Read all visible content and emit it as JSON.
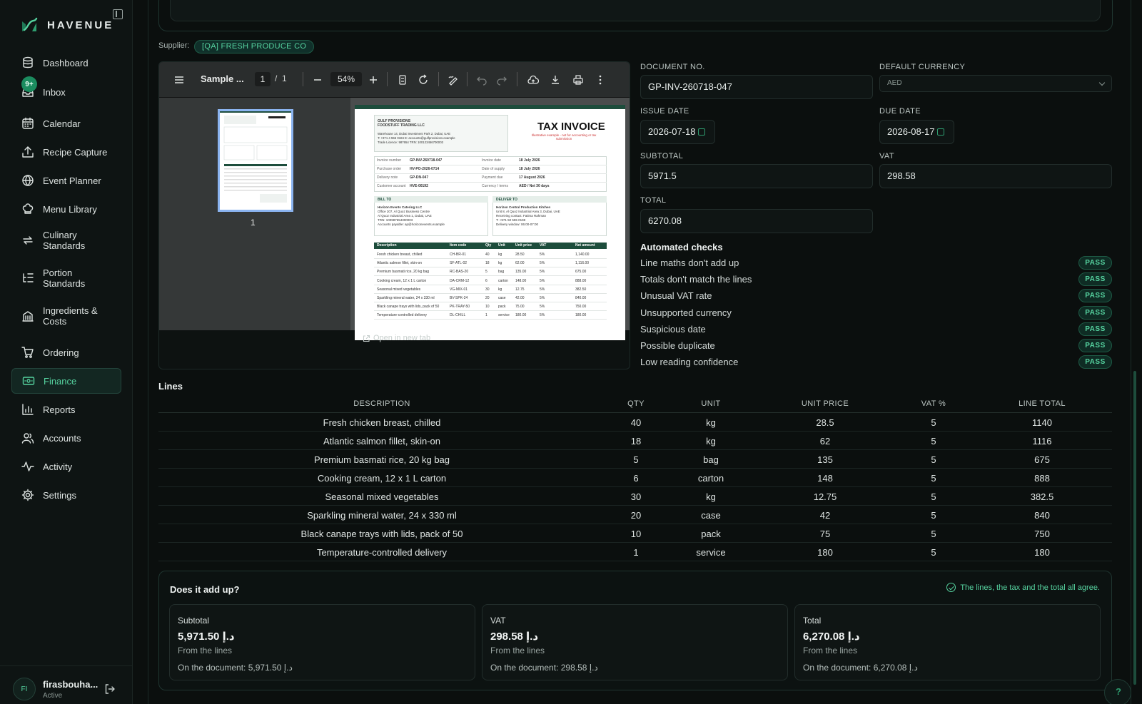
{
  "brand": {
    "name": "HAVENUE"
  },
  "sidebar": {
    "items": [
      {
        "label": "Dashboard",
        "icon": "database-icon"
      },
      {
        "label": "Inbox",
        "icon": "inbox-icon",
        "badge": "9+"
      },
      {
        "label": "Calendar",
        "icon": "calendar-icon"
      },
      {
        "label": "Recipe Capture",
        "icon": "upload-icon"
      },
      {
        "label": "Event Planner",
        "icon": "globe-icon"
      },
      {
        "label": "Menu Library",
        "icon": "chef-hat-icon"
      },
      {
        "label": "Culinary\nStandards",
        "icon": "repeat-icon"
      },
      {
        "label": "Portion\nStandards",
        "icon": "list-tree-icon"
      },
      {
        "label": "Ingredients &\nCosts",
        "icon": "building-icon"
      },
      {
        "label": "Ordering",
        "icon": "cart-icon"
      },
      {
        "label": "Finance",
        "icon": "banknote-icon",
        "active": true
      },
      {
        "label": "Reports",
        "icon": "bar-chart-icon"
      },
      {
        "label": "Accounts",
        "icon": "users-icon"
      },
      {
        "label": "Activity",
        "icon": "activity-icon"
      },
      {
        "label": "Settings",
        "icon": "gear-icon"
      }
    ],
    "user": {
      "initials": "FI",
      "name": "firasbouha...",
      "status": "Active"
    }
  },
  "supplier": {
    "label": "Supplier:",
    "name": "[QA] FRESH PRODUCE CO"
  },
  "pdf": {
    "title": "Sample ...",
    "page_current": "1",
    "page_sep": "/",
    "page_total": "1",
    "zoom": "54%",
    "thumb_label": "1",
    "open_new_tab": "Open in new tab",
    "invoice": {
      "title": "TAX INVOICE",
      "subtitle": "Illustrative example - not for accounting or tax submission",
      "seller_name": "GULF PROVISIONS",
      "seller_name2": "FOODSTUFF TRADING LLC",
      "seller_lines": [
        "Warehouse 14, Dubai Investment Park 2, Dubai, UAE",
        "T: +971 4 555 0184   E: accounts@gulfprovisions.example",
        "Trade Licence: 987654   TRN: 100123456700003"
      ],
      "meta": [
        {
          "k": "Invoice number",
          "v": "GP-INV-260718-047",
          "k2": "Invoice date",
          "v2": "18 July 2026"
        },
        {
          "k": "Purchase order",
          "v": "HV-PO-2026-0714",
          "k2": "Date of supply",
          "v2": "18 July 2026"
        },
        {
          "k": "Delivery note",
          "v": "GP-DN-047",
          "k2": "Payment due",
          "v2": "17 August 2026"
        },
        {
          "k": "Customer account",
          "v": "HVE-00192",
          "k2": "Currency / terms",
          "v2": "AED / Net 30 days"
        }
      ],
      "bill_to_label": "BILL TO",
      "bill_to": [
        "Horizon Events Catering LLC",
        "Office 207, Al Quoz Business Centre",
        "Al Quoz Industrial Area 1, Dubai, UAE",
        "TRN: 100987654300003",
        "Accounts payable: ap@horizonevents.example"
      ],
      "deliver_to_label": "DELIVER TO",
      "deliver_to": [
        "Horizon Central Production Kitchen",
        "Unit 8, Al Quoz Industrial Area 3, Dubai, UAE",
        "Receiving contact: Fatima Rahman",
        "T: +971 50 555 0198",
        "Delivery window: 06:00-07:00"
      ],
      "table_headers": [
        "Description",
        "Item code",
        "Qty",
        "Unit",
        "Unit price",
        "VAT",
        "Net amount"
      ],
      "rows": [
        [
          "Fresh chicken breast, chilled",
          "CH-BR-01",
          "40",
          "kg",
          "28.50",
          "5%",
          "1,140.00"
        ],
        [
          "Atlantic salmon fillet, skin-on",
          "SF-ATL-02",
          "18",
          "kg",
          "62.00",
          "5%",
          "1,116.00"
        ],
        [
          "Premium basmati rice, 20 kg bag",
          "RC-BAS-20",
          "5",
          "bag",
          "135.00",
          "5%",
          "675.00"
        ],
        [
          "Cooking cream, 12 x 1 L carton",
          "DA-CRM-12",
          "6",
          "carton",
          "148.00",
          "5%",
          "888.00"
        ],
        [
          "Seasonal mixed vegetables",
          "VG-MIX-01",
          "30",
          "kg",
          "12.75",
          "5%",
          "382.50"
        ],
        [
          "Sparkling mineral water, 24 x 330 ml",
          "BV-SPK-24",
          "20",
          "case",
          "42.00",
          "5%",
          "840.00"
        ],
        [
          "Black canape trays with lids, pack of 50",
          "PK-TRAY-50",
          "10",
          "pack",
          "75.00",
          "5%",
          "750.00"
        ],
        [
          "Temperature-controlled delivery",
          "DL-CHILL",
          "1",
          "service",
          "180.00",
          "5%",
          "180.00"
        ]
      ]
    }
  },
  "form": {
    "document_no": {
      "label": "DOCUMENT NO.",
      "value": "GP-INV-260718-047"
    },
    "default_currency": {
      "label": "DEFAULT CURRENCY",
      "value": "AED"
    },
    "issue_date": {
      "label": "ISSUE DATE",
      "value": "2026-07-18"
    },
    "due_date": {
      "label": "DUE DATE",
      "value": "2026-08-17"
    },
    "subtotal": {
      "label": "SUBTOTAL",
      "value": "5971.5"
    },
    "vat": {
      "label": "VAT",
      "value": "298.58"
    },
    "total": {
      "label": "TOTAL",
      "value": "6270.08"
    }
  },
  "checks": {
    "title": "Automated checks",
    "items": [
      {
        "label": "Line maths don't add up",
        "status": "PASS"
      },
      {
        "label": "Totals don't match the lines",
        "status": "PASS"
      },
      {
        "label": "Unusual VAT rate",
        "status": "PASS"
      },
      {
        "label": "Unsupported currency",
        "status": "PASS"
      },
      {
        "label": "Suspicious date",
        "status": "PASS"
      },
      {
        "label": "Possible duplicate",
        "status": "PASS"
      },
      {
        "label": "Low reading confidence",
        "status": "PASS"
      }
    ],
    "status_color": "#56d3a0"
  },
  "lines": {
    "title": "Lines",
    "headers": [
      "DESCRIPTION",
      "QTY",
      "UNIT",
      "UNIT PRICE",
      "VAT %",
      "LINE TOTAL"
    ],
    "rows": [
      [
        "Fresh chicken breast, chilled",
        "40",
        "kg",
        "28.5",
        "5",
        "1140"
      ],
      [
        "Atlantic salmon fillet, skin-on",
        "18",
        "kg",
        "62",
        "5",
        "1116"
      ],
      [
        "Premium basmati rice, 20 kg bag",
        "5",
        "bag",
        "135",
        "5",
        "675"
      ],
      [
        "Cooking cream, 12 x 1 L carton",
        "6",
        "carton",
        "148",
        "5",
        "888"
      ],
      [
        "Seasonal mixed vegetables",
        "30",
        "kg",
        "12.75",
        "5",
        "382.5"
      ],
      [
        "Sparkling mineral water, 24 x 330 ml",
        "20",
        "case",
        "42",
        "5",
        "840"
      ],
      [
        "Black canape trays with lids, pack of 50",
        "10",
        "pack",
        "75",
        "5",
        "750"
      ],
      [
        "Temperature-controlled delivery",
        "1",
        "service",
        "180",
        "5",
        "180"
      ]
    ]
  },
  "addup": {
    "title": "Does it add up?",
    "ok_message": "The lines, the tax and the total all agree.",
    "cards": [
      {
        "label": "Subtotal",
        "value": "5,971.50 د.إ",
        "from": "From the lines",
        "doc": "On the document: 5,971.50 د.إ"
      },
      {
        "label": "VAT",
        "value": "298.58 د.إ",
        "from": "From the lines",
        "doc": "On the document: 298.58 د.إ"
      },
      {
        "label": "Total",
        "value": "6,270.08 د.إ",
        "from": "From the lines",
        "doc": "On the document: 6,270.08 د.إ"
      }
    ]
  },
  "theme": {
    "accent": "#56d3a0",
    "background": "#0b0f0e",
    "panel": "#0f1514"
  }
}
